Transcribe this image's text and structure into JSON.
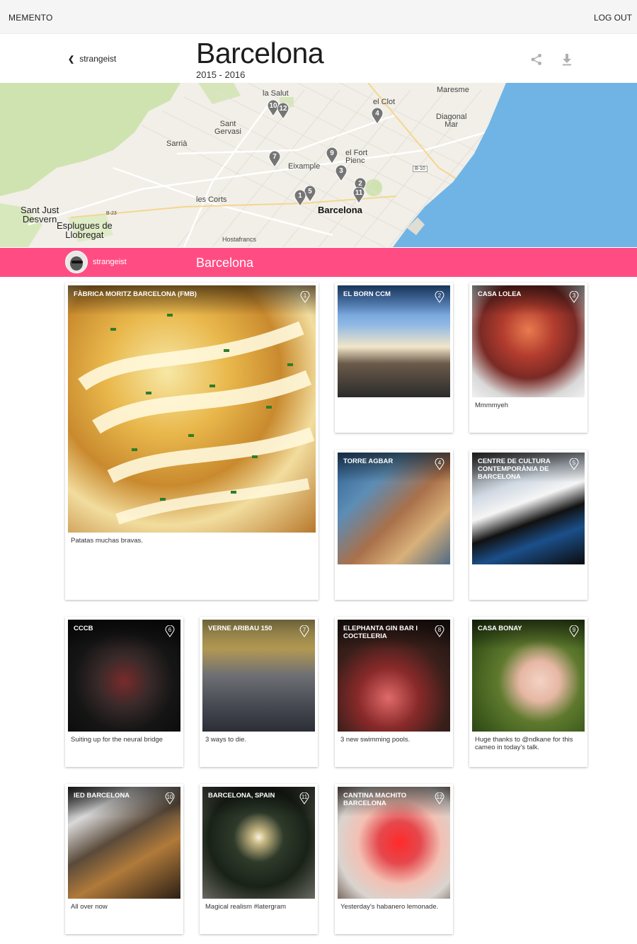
{
  "topbar": {
    "brand": "MEMENTO",
    "logout": "LOG OUT"
  },
  "header": {
    "back_label": "strangeist",
    "title": "Barcelona",
    "years": "2015 - 2016",
    "share_icon": "share-icon",
    "download_icon": "download-icon"
  },
  "map": {
    "labels": {
      "la_salut": "la Salut",
      "el_clot": "el Clot",
      "maresme": "Maresme",
      "diagonal_mar": "Diagonal\nMar",
      "sant_gervasi": "Sant\nGervasi",
      "sarria": "Sarrià",
      "el_fort_pienc": "el Fort\nPienc",
      "eixample": "Eixample",
      "les_corts": "les Corts",
      "sant_just": "Sant Just\nDesvern",
      "esplugues": "Esplugues de\nLlobregat",
      "barcelona": "Barcelona",
      "hostafrancs": "Hostafrancs",
      "b10": "B-10",
      "b23": "B-23"
    },
    "pins": [
      "1",
      "2",
      "3",
      "4",
      "5",
      "7",
      "9",
      "10",
      "11",
      "12"
    ],
    "colors": {
      "water": "#70b4e6",
      "park": "#cfe3b0",
      "land": "#f1efe8",
      "pin": "#757575"
    }
  },
  "bar": {
    "username": "strangeist",
    "title": "Barcelona",
    "color": "#ff4d84"
  },
  "moments": [
    {
      "place": "FÀBRICA MORITZ BARCELONA (FMB)",
      "num": "1",
      "caption": "Patatas muchas bravas."
    },
    {
      "place": "EL BORN CCM",
      "num": "2",
      "caption": ""
    },
    {
      "place": "CASA LOLEA",
      "num": "3",
      "caption": "Mmmmyeh"
    },
    {
      "place": "TORRE AGBAR",
      "num": "4",
      "caption": ""
    },
    {
      "place": "CENTRE DE CULTURA CONTEMPORÀNIA DE BARCELONA",
      "num": "5",
      "caption": ""
    },
    {
      "place": "CCCB",
      "num": "6",
      "caption": "Suiting up for the neural bridge"
    },
    {
      "place": "VERNE ARIBAU 150",
      "num": "7",
      "caption": "3 ways to die."
    },
    {
      "place": "ELEPHANTA GIN BAR I COCTELERIA",
      "num": "8",
      "caption": "3 new swimming pools."
    },
    {
      "place": "CASA BONAY",
      "num": "9",
      "caption": "Huge thanks to @ndkane for this cameo in today's talk."
    },
    {
      "place": "IED BARCELONA",
      "num": "10",
      "caption": "All over now"
    },
    {
      "place": "BARCELONA, SPAIN",
      "num": "11",
      "caption": "Magical realism #latergram"
    },
    {
      "place": "CANTINA MACHITO BARCELONA",
      "num": "12",
      "caption": "Yesterday's habanero lemonade."
    }
  ]
}
